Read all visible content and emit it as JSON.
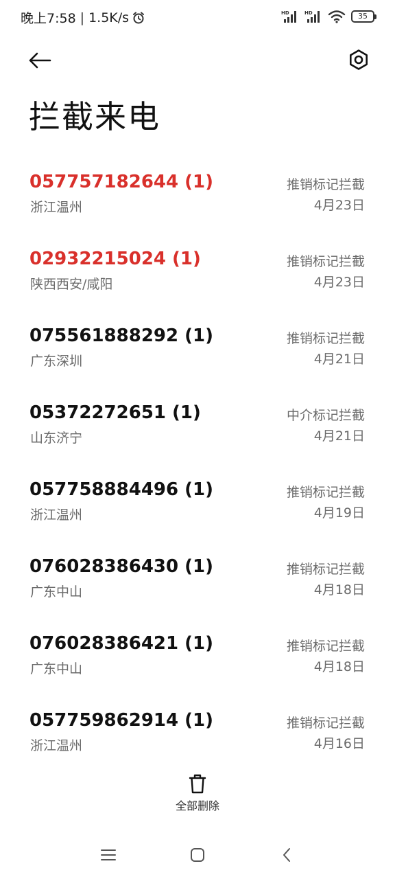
{
  "status_bar": {
    "time": "晚上7:58",
    "separator": "|",
    "speed": "1.5K/s",
    "icons": [
      "alarm-icon",
      "hd-signal-icon",
      "hd-signal-icon",
      "wifi-icon",
      "battery-icon"
    ],
    "battery_level": "35"
  },
  "header": {
    "title": "拦截来电",
    "back_icon": "back-arrow-icon",
    "settings_icon": "settings-icon"
  },
  "calls": [
    {
      "number": "057757182644 (1)",
      "location": "浙江温州",
      "tag": "推销标记拦截",
      "date": "4月23日",
      "highlight": true
    },
    {
      "number": "02932215024 (1)",
      "location": "陕西西安/咸阳",
      "tag": "推销标记拦截",
      "date": "4月23日",
      "highlight": true
    },
    {
      "number": "075561888292 (1)",
      "location": "广东深圳",
      "tag": "推销标记拦截",
      "date": "4月21日",
      "highlight": false
    },
    {
      "number": "05372272651 (1)",
      "location": "山东济宁",
      "tag": "中介标记拦截",
      "date": "4月21日",
      "highlight": false
    },
    {
      "number": "057758884496 (1)",
      "location": "浙江温州",
      "tag": "推销标记拦截",
      "date": "4月19日",
      "highlight": false
    },
    {
      "number": "076028386430 (1)",
      "location": "广东中山",
      "tag": "推销标记拦截",
      "date": "4月18日",
      "highlight": false
    },
    {
      "number": "076028386421 (1)",
      "location": "广东中山",
      "tag": "推销标记拦截",
      "date": "4月18日",
      "highlight": false
    },
    {
      "number": "057759862914 (1)",
      "location": "浙江温州",
      "tag": "推销标记拦截",
      "date": "4月16日",
      "highlight": false
    }
  ],
  "footer": {
    "delete_all_label": "全部删除",
    "delete_icon": "trash-icon"
  },
  "nav": {
    "icons": [
      "menu-icon",
      "home-icon",
      "back-icon"
    ]
  },
  "colors": {
    "highlight": "#d9302b",
    "primary_text": "#111111",
    "secondary_text": "#6a6a6a"
  }
}
